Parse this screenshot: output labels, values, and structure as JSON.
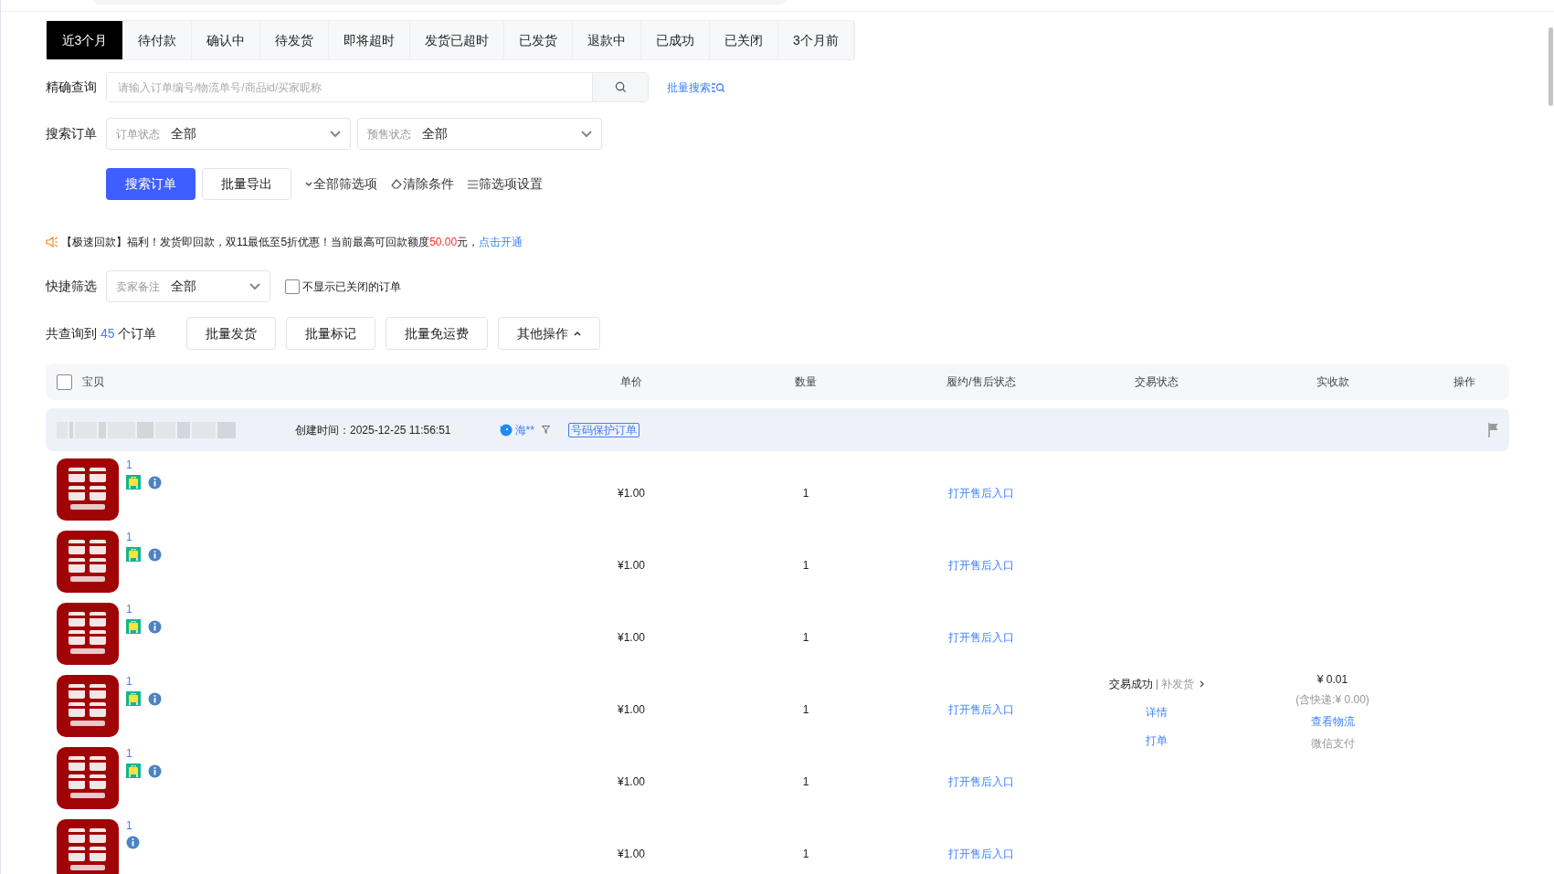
{
  "tabs": [
    {
      "label": "近3个月",
      "selected": true
    },
    {
      "label": "待付款",
      "selected": false
    },
    {
      "label": "确认中",
      "selected": false
    },
    {
      "label": "待发货",
      "selected": false
    },
    {
      "label": "即将超时",
      "selected": false
    },
    {
      "label": "发货已超时",
      "selected": false
    },
    {
      "label": "已发货",
      "selected": false
    },
    {
      "label": "退款中",
      "selected": false
    },
    {
      "label": "已成功",
      "selected": false
    },
    {
      "label": "已关闭",
      "selected": false
    },
    {
      "label": "3个月前",
      "selected": false
    }
  ],
  "exact_search": {
    "label": "精确查询",
    "placeholder": "请输入订单编号/物流单号/商品id/买家昵称",
    "batch_link": "批量搜索"
  },
  "search_orders": {
    "label": "搜索订单",
    "selects": [
      {
        "label": "订单状态",
        "value": "全部"
      },
      {
        "label": "预售状态",
        "value": "全部"
      }
    ]
  },
  "actions": {
    "primary": "搜索订单",
    "export": "批量导出",
    "links": [
      {
        "kind": "expand",
        "label": "全部筛选项"
      },
      {
        "kind": "clear",
        "label": "清除条件"
      },
      {
        "kind": "settings",
        "label": "筛选项设置"
      }
    ]
  },
  "notice": {
    "before": "【极速回款】福利！发货即回款，双11最低至5折优惠！当前最高可回款额度",
    "amount": "50.00",
    "after": "元，",
    "link": "点击开通"
  },
  "quick_filter": {
    "label": "快捷筛选",
    "select": {
      "label": "卖家备注",
      "value": "全部"
    },
    "checkbox": {
      "label": "不显示已关闭的订单",
      "checked": false
    }
  },
  "summary": {
    "prefix": "共查询到",
    "count": "45",
    "suffix": "个订单",
    "buttons": [
      {
        "label": "批量发货",
        "kind": "plain"
      },
      {
        "label": "批量标记",
        "kind": "plain"
      },
      {
        "label": "批量免运费",
        "kind": "plain"
      },
      {
        "label": "其他操作",
        "kind": "dropdown",
        "expanded": true
      }
    ]
  },
  "table": {
    "select_all": {
      "checked": false
    },
    "columns": [
      "宝贝",
      "单价",
      "数量",
      "履约/售后状态",
      "交易状态",
      "实收款",
      "操作"
    ],
    "orders": [
      {
        "created": "创建时间：2025-12-25 11:56:51",
        "buyer": "海**",
        "tag": "号码保护订单",
        "items": [
          {
            "qty_link": "1",
            "shop_badge": true,
            "price": "¥1.00",
            "quantity": "1",
            "after_sale": "打开售后入口"
          },
          {
            "qty_link": "1",
            "shop_badge": true,
            "price": "¥1.00",
            "quantity": "1",
            "after_sale": "打开售后入口"
          },
          {
            "qty_link": "1",
            "shop_badge": true,
            "price": "¥1.00",
            "quantity": "1",
            "after_sale": "打开售后入口"
          },
          {
            "qty_link": "1",
            "shop_badge": true,
            "price": "¥1.00",
            "quantity": "1",
            "after_sale": "打开售后入口"
          },
          {
            "qty_link": "1",
            "shop_badge": true,
            "price": "¥1.00",
            "quantity": "1",
            "after_sale": "打开售后入口"
          },
          {
            "qty_link": "1",
            "shop_badge": false,
            "price": "¥1.00",
            "quantity": "1",
            "after_sale": "打开售后入口"
          }
        ],
        "trade": {
          "status": "交易成功",
          "extra": "补发货",
          "links": [
            "详情",
            "打单"
          ]
        },
        "received": {
          "amount": "¥ 0.01",
          "shipping": "(含快递:¥ 0.00)",
          "logistics": "查看物流",
          "payment": "微信支付"
        }
      }
    ]
  }
}
